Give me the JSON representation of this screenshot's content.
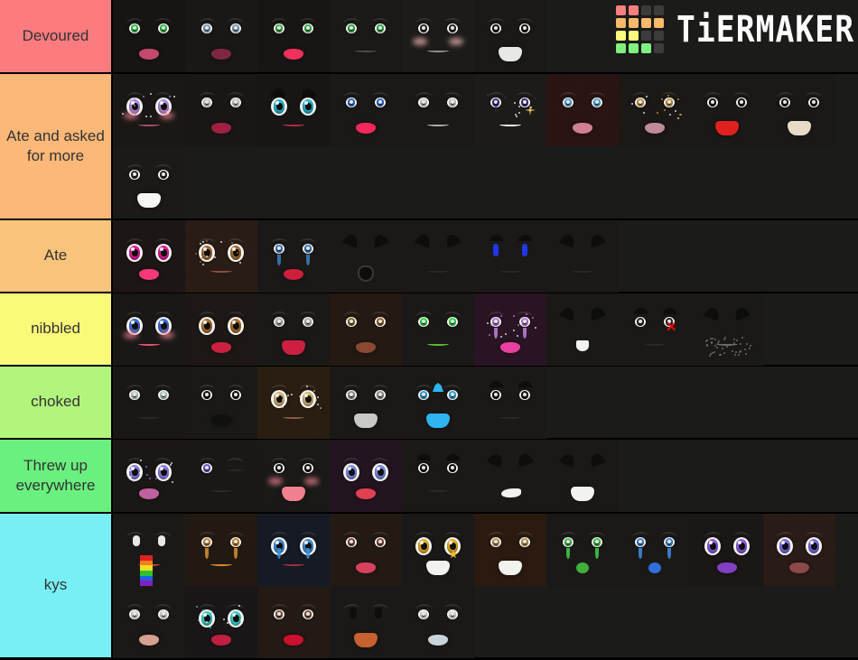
{
  "app": {
    "title": "TierMaker Tier List",
    "background_color": "#1b1b19",
    "border_color": "#000000",
    "label_text_color": "#333333"
  },
  "watermark": {
    "brand": "TiERMAKER",
    "grid_colors": [
      "#fa7f7f",
      "#fa7f7f",
      "#3c3c3c",
      "#3c3c3c",
      "#fbb96b",
      "#fbb96b",
      "#fbb96b",
      "#fbb96b",
      "#fafa7f",
      "#fafa7f",
      "#3c3c3c",
      "#3c3c3c",
      "#7ff07f",
      "#7ff07f",
      "#7ff07f",
      "#3c3c3c"
    ]
  },
  "tiers": [
    {
      "label": "Devoured",
      "color": "#fb7b7f",
      "height": 82,
      "item_count": 6,
      "items": [
        {
          "name": "face-green-eyes-dark-lips",
          "skin": "#161513",
          "eye": "#2fd14a",
          "lip": "#c4496c",
          "style": "glam-green"
        },
        {
          "name": "face-blue-eyes-smirk",
          "skin": "#1a1816",
          "eye": "#7fa8c9",
          "lip": "#7e2740",
          "style": "smirk"
        },
        {
          "name": "face-green-eyes-pink-lips",
          "skin": "#171614",
          "eye": "#3fc24f",
          "lip": "#f0305c",
          "style": "kiss"
        },
        {
          "name": "face-green-eyes-flat-mouth",
          "skin": "#1a1917",
          "eye": "#2fb84a",
          "lip": "#4a4a48",
          "style": "flat"
        },
        {
          "name": "face-blush-smile",
          "skin": "#1d1b19",
          "eye": "#2b2a28",
          "lip": "#8c8c8a",
          "style": "blush-smile"
        },
        {
          "name": "face-open-mouth-teeth",
          "skin": "#1a1917",
          "eye": "#131211",
          "lip": "#e8e8e4",
          "style": "open-teeth"
        }
      ]
    },
    {
      "label": "Ate and asked for more",
      "color": "#fcb878",
      "height": 162,
      "item_count": 11,
      "items": [
        {
          "name": "face-sparkle-purple-eyes",
          "skin": "#1a1715",
          "eye": "#b48de0",
          "lip": "#9e4f64",
          "style": "sparkle-anime"
        },
        {
          "name": "face-dark-brows-red-lips",
          "skin": "#191715",
          "eye": "#d8d4cf",
          "lip": "#a02040",
          "style": "glam-red"
        },
        {
          "name": "face-cyan-eyes-angry-brows",
          "skin": "#181614",
          "eye": "#2bb8d6",
          "lip": "#b02a4a",
          "style": "anime-cyan"
        },
        {
          "name": "face-blue-eyes-pink-lips",
          "skin": "#1b1917",
          "eye": "#2f6fd8",
          "lip": "#f5275e",
          "style": "kiss-blue"
        },
        {
          "name": "face-silver-eyes-ghost",
          "skin": "#1a1816",
          "eye": "#d4d4d4",
          "lip": "#a8a8a8",
          "style": "ghost"
        },
        {
          "name": "face-wink-sparkle",
          "skin": "#1e1a18",
          "eye": "#3d2f86",
          "lip": "#f0f0ec",
          "style": "sparkle-wink"
        },
        {
          "name": "face-red-glow-blue-eyes",
          "skin": "#2a1414",
          "eye": "#4fb4e8",
          "lip": "#d08090",
          "style": "red-glow"
        },
        {
          "name": "face-gold-brows-glitter",
          "skin": "#1b1816",
          "eye": "#d4a23c",
          "lip": "#c08a9a",
          "style": "gold-glam"
        },
        {
          "name": "face-red-open-smile",
          "skin": "#1a1917",
          "eye": "#131211",
          "lip": "#e02020",
          "style": "red-smile"
        },
        {
          "name": "face-cream-open-smile",
          "skin": "#1a1917",
          "eye": "#131211",
          "lip": "#e8dcc8",
          "style": "cream-smile"
        },
        {
          "name": "face-white-smile-small-eyes",
          "skin": "#1a1917",
          "eye": "#2a2826",
          "lip": "#f2f2ee",
          "style": "white-smile"
        }
      ]
    },
    {
      "label": "Ate",
      "color": "#fbc47c",
      "height": 81,
      "item_count": 7,
      "items": [
        {
          "name": "face-magenta-eyes-pink-lips",
          "skin": "#1d1715",
          "eye": "#e81fa0",
          "lip": "#f5387a",
          "style": "magenta"
        },
        {
          "name": "face-brown-eyes-freckles",
          "skin": "#2a1d16",
          "eye": "#a87038",
          "lip": "#8a5040",
          "style": "brown-freckle"
        },
        {
          "name": "face-blue-eyes-crying-red-lips",
          "skin": "#1b1917",
          "eye": "#3f7fc4",
          "lip": "#cc1f3c",
          "style": "cry-blue"
        },
        {
          "name": "face-angry-brows-open-mouth",
          "skin": "#1a1917",
          "eye": "#121110",
          "lip": "#1a1a18",
          "style": "angry-open"
        },
        {
          "name": "face-angry-brows-flat",
          "skin": "#1a1917",
          "eye": "#121110",
          "lip": "#2a2826",
          "style": "angry-flat"
        },
        {
          "name": "face-blue-slit-eyes",
          "skin": "#1a1917",
          "eye": "#2036e8",
          "lip": "#2a2826",
          "style": "blue-slit"
        },
        {
          "name": "face-angry-smirk",
          "skin": "#1a1917",
          "eye": "#121110",
          "lip": "#2a2826",
          "style": "angry-smirk"
        }
      ]
    },
    {
      "label": "nibbled",
      "color": "#fafa7a",
      "height": 81,
      "item_count": 9,
      "items": [
        {
          "name": "face-big-blue-anime-eyes",
          "skin": "#1a1816",
          "eye": "#3f6fd8",
          "lip": "#e05070",
          "style": "anime-big-blue"
        },
        {
          "name": "face-brown-anime-eyes",
          "skin": "#1d1815",
          "eye": "#b0742c",
          "lip": "#cc2040",
          "style": "anime-brown"
        },
        {
          "name": "face-zombie-teeth",
          "skin": "#1a1917",
          "eye": "#bdbdbd",
          "lip": "#cc2040",
          "style": "zombie"
        },
        {
          "name": "face-brown-brows-pout",
          "skin": "#241a13",
          "eye": "#9c6a30",
          "lip": "#8a4a30",
          "style": "brown-pout"
        },
        {
          "name": "face-green-neon-smile",
          "skin": "#1a1917",
          "eye": "#2ff04a",
          "lip": "#5fb830",
          "style": "neon-green"
        },
        {
          "name": "face-pink-glitter-eyes",
          "skin": "#2a1525",
          "eye": "#c080e0",
          "lip": "#e840a0",
          "style": "pink-glitter"
        },
        {
          "name": "face-vampire-fangs",
          "skin": "#1a1917",
          "eye": "#121110",
          "lip": "#f2f2ee",
          "style": "vampire"
        },
        {
          "name": "face-red-x-sad",
          "skin": "#1a1917",
          "eye": "#2a2826",
          "lip": "#2a2826",
          "style": "red-x"
        },
        {
          "name": "face-scribble-angry",
          "skin": "#1a1917",
          "eye": "#121110",
          "lip": "#6a6a68",
          "style": "scribble"
        }
      ]
    },
    {
      "label": "choked",
      "color": "#b2f57d",
      "height": 81,
      "item_count": 6,
      "items": [
        {
          "name": "face-pale-blue-eyes",
          "skin": "#1a1816",
          "eye": "#c8dcdc",
          "lip": "#2a2826",
          "style": "pale-eyes"
        },
        {
          "name": "face-closed-eyes-black-lips",
          "skin": "#1a1917",
          "eye": "#121110",
          "lip": "#101010",
          "style": "black-lips"
        },
        {
          "name": "face-golden-glitter-eyes",
          "skin": "#2a1e12",
          "eye": "#d8b878",
          "lip": "#8a5a42",
          "style": "gold-glitter"
        },
        {
          "name": "face-outline-grin",
          "skin": "#1a1917",
          "eye": "#9a9a98",
          "lip": "#c8c8c4",
          "style": "outline-grin"
        },
        {
          "name": "face-cyan-crown-grin",
          "skin": "#1a1917",
          "eye": "#2fb4f0",
          "lip": "#2fb4f0",
          "style": "cyan-crown"
        },
        {
          "name": "face-sleepy-wavy-mouth",
          "skin": "#1a1917",
          "eye": "#121110",
          "lip": "#2a2826",
          "style": "sleepy"
        }
      ]
    },
    {
      "label": "Threw up everywhere",
      "color": "#6af07e",
      "height": 82,
      "item_count": 7,
      "items": [
        {
          "name": "face-rainbow-glitter-eyes",
          "skin": "#1b1715",
          "eye": "#8f7fe8",
          "lip": "#c060a0",
          "style": "rainbow-eyes"
        },
        {
          "name": "face-wink-purple-eye",
          "skin": "#1a1816",
          "eye": "#6f5fd8",
          "lip": "#2a2826",
          "style": "wink-purple"
        },
        {
          "name": "face-blush-lines-open-mouth",
          "skin": "#1a1917",
          "eye": "#121110",
          "lip": "#f07f8f",
          "style": "blush-lines"
        },
        {
          "name": "face-purple-eyes-red-lips",
          "skin": "#231520",
          "eye": "#7f8fe8",
          "lip": "#e04050",
          "style": "purple-glam"
        },
        {
          "name": "face-flat-brows-smile",
          "skin": "#1a1917",
          "eye": "#121110",
          "lip": "#2a2826",
          "style": "flat-brow-smile"
        },
        {
          "name": "face-angry-white-smirk",
          "skin": "#1a1917",
          "eye": "#121110",
          "lip": "#f2f2ee",
          "style": "white-smirk"
        },
        {
          "name": "face-angry-gritted-teeth",
          "skin": "#1a1917",
          "eye": "#121110",
          "lip": "#f2f2ee",
          "style": "gritted"
        }
      ]
    },
    {
      "label": "kys",
      "color": "#77eff5",
      "height": 161,
      "item_count": 15,
      "items": [
        {
          "name": "face-rainbow-flag-eyes",
          "skin": "#1a1917",
          "eye": "#e8e8e4",
          "lip": "#e04040",
          "style": "rainbow-flag"
        },
        {
          "name": "face-orange-crying-eyes",
          "skin": "#221a12",
          "eye": "#d89030",
          "lip": "#d08a30",
          "style": "orange-cry"
        },
        {
          "name": "face-blue-crying-eyes",
          "skin": "#151a24",
          "eye": "#3f8fd8",
          "lip": "#a03040",
          "style": "blue-cry"
        },
        {
          "name": "face-brown-brows-red-lips",
          "skin": "#241a14",
          "eye": "#8a4a3a",
          "lip": "#d84060",
          "style": "brown-glam"
        },
        {
          "name": "face-star-eyes-grin",
          "skin": "#1a1917",
          "eye": "#f0b020",
          "lip": "#f2f2ee",
          "style": "star-eyes"
        },
        {
          "name": "face-gold-brows-white-mouth",
          "skin": "#2a1a10",
          "eye": "#c8a050",
          "lip": "#f2f2ee",
          "style": "gold-white"
        },
        {
          "name": "face-green-crying-eyes",
          "skin": "#1a1917",
          "eye": "#3fd04a",
          "lip": "#3fb03a",
          "style": "green-cry"
        },
        {
          "name": "face-blue-tears-eyes",
          "skin": "#1a1917",
          "eye": "#3f8fe8",
          "lip": "#2f6fd8",
          "style": "blue-tears"
        },
        {
          "name": "face-purple-blue-eyes",
          "skin": "#1a1715",
          "eye": "#8f5fe8",
          "lip": "#8040c0",
          "style": "purple-blue"
        },
        {
          "name": "face-purple-eyes-dark-skin",
          "skin": "#2a1c18",
          "eye": "#7f6fe8",
          "lip": "#8a4a4a",
          "style": "purple-dark"
        },
        {
          "name": "face-white-eyes-nude-lips",
          "skin": "#1a1917",
          "eye": "#e8e8e4",
          "lip": "#d8a090",
          "style": "nude-lips"
        },
        {
          "name": "face-teal-glitter-eyes",
          "skin": "#1b1719",
          "eye": "#3fd0c8",
          "lip": "#c02040",
          "style": "teal-glitter"
        },
        {
          "name": "face-brown-brows-red-lip-bite",
          "skin": "#231a15",
          "eye": "#8a5a40",
          "lip": "#cc1030",
          "style": "lip-bite"
        },
        {
          "name": "face-nostrils-open-smile",
          "skin": "#1a1917",
          "eye": "#121110",
          "lip": "#c86030",
          "style": "nostril-smile"
        },
        {
          "name": "face-white-eyes-silver-lips",
          "skin": "#1a1917",
          "eye": "#f0f0ec",
          "lip": "#c8d4d8",
          "style": "silver-lips"
        }
      ]
    }
  ]
}
